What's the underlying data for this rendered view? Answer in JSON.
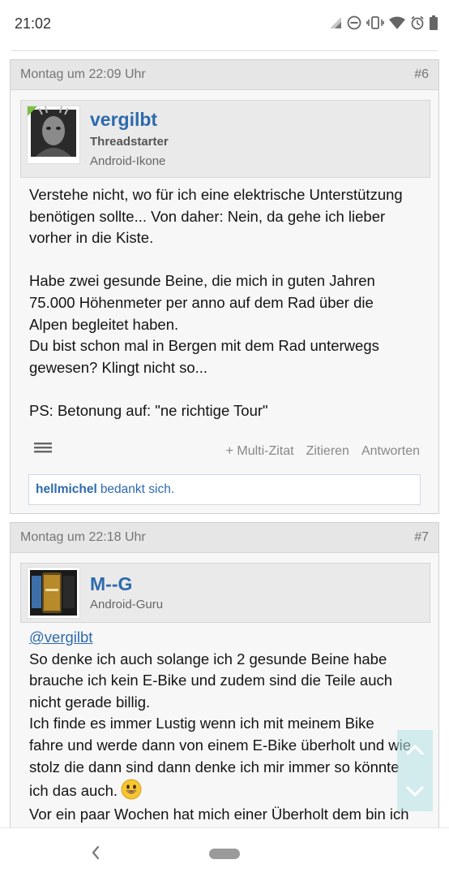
{
  "status": {
    "time": "21:02"
  },
  "posts": [
    {
      "date": "Montag um 22:09 Uhr",
      "number": "#6",
      "author": {
        "name": "vergilbt",
        "role": "Threadstarter",
        "rank": "Android-Ikone"
      },
      "lines": [
        "Verstehe nicht, wo für ich eine elektrische Unterstützung",
        "benötigen sollte... Von daher: Nein, da gehe ich lieber",
        "vorher in die Kiste.",
        "",
        "Habe zwei gesunde Beine, die mich in guten Jahren",
        "75.000 Höhenmeter per anno auf dem Rad über die",
        "Alpen begleitet haben.",
        "Du bist schon mal in Bergen mit dem Rad unterwegs",
        "gewesen? Klingt nicht so...",
        "",
        "PS: Betonung auf: \"ne richtige Tour\""
      ],
      "actions": {
        "multi_quote": "+ Multi-Zitat",
        "quote": "Zitieren",
        "reply": "Antworten"
      },
      "thanks": {
        "user": "hellmichel",
        "text": "bedankt sich."
      }
    },
    {
      "date": "Montag um 22:18 Uhr",
      "number": "#7",
      "author": {
        "name": "M--G",
        "rank": "Android-Guru"
      },
      "mention": "@vergilbt",
      "lines": [
        "So denke ich auch solange ich 2 gesunde Beine habe",
        "brauche ich kein E-Bike und zudem sind die Teile auch",
        "nicht gerade billig.",
        "Ich finde es immer Lustig wenn ich mit meinem Bike",
        "fahre und werde dann von einem E-Bike überholt und wie",
        "stolz die dann sind dann denke ich mir immer so könnte",
        "ich das auch.",
        "Vor ein paar Wochen hat mich einer Überholt dem bin ich"
      ]
    }
  ],
  "colors": {
    "link": "#2d6aad",
    "header_bg": "#e6e6e6",
    "post_bg": "#f7f7f7"
  }
}
